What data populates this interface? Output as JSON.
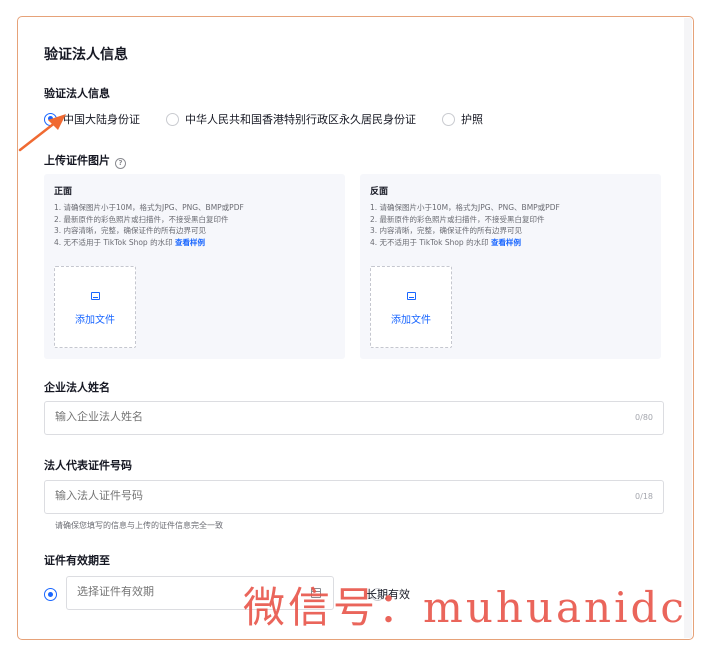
{
  "section_title": "验证法人信息",
  "verify_label": "验证法人信息",
  "id_types": [
    {
      "label": "中国大陆身份证",
      "selected": true
    },
    {
      "label": "中华人民共和国香港特别行政区永久居民身份证",
      "selected": false
    },
    {
      "label": "护照",
      "selected": false
    }
  ],
  "upload": {
    "label": "上传证件图片",
    "info_icon": "?",
    "panels": [
      {
        "title": "正面",
        "notes": [
          "1. 请确保图片小于10M，格式为JPG、PNG、BMP或PDF",
          "2. 最新原件的彩色照片或扫描件，不接受黑白复印件",
          "3. 内容清晰，完整，确保证件的所有边界可见",
          "4. 无不适用于 TikTok Shop 的水印"
        ],
        "sample_link": "查看样例",
        "add_label": "添加文件"
      },
      {
        "title": "反面",
        "notes": [
          "1. 请确保图片小于10M，格式为JPG、PNG、BMP或PDF",
          "2. 最新原件的彩色照片或扫描件，不接受黑白复印件",
          "3. 内容清晰，完整，确保证件的所有边界可见",
          "4. 无不适用于 TikTok Shop 的水印"
        ],
        "sample_link": "查看样例",
        "add_label": "添加文件"
      }
    ]
  },
  "legal_name": {
    "label": "企业法人姓名",
    "placeholder": "输入企业法人姓名",
    "counter": "0/80"
  },
  "id_number": {
    "label": "法人代表证件号码",
    "placeholder": "输入法人证件号码",
    "counter": "0/18",
    "hint": "请确保您填写的信息与上传的证件信息完全一致"
  },
  "validity": {
    "label": "证件有效期至",
    "placeholder": "选择证件有效期",
    "long_term_label": "长期有效"
  },
  "watermark": "微信号：muhuanidc",
  "colors": {
    "accent": "#1966ff",
    "border_highlight": "#e6a279",
    "arrow": "#f06a32",
    "watermark": "#e8554a"
  }
}
